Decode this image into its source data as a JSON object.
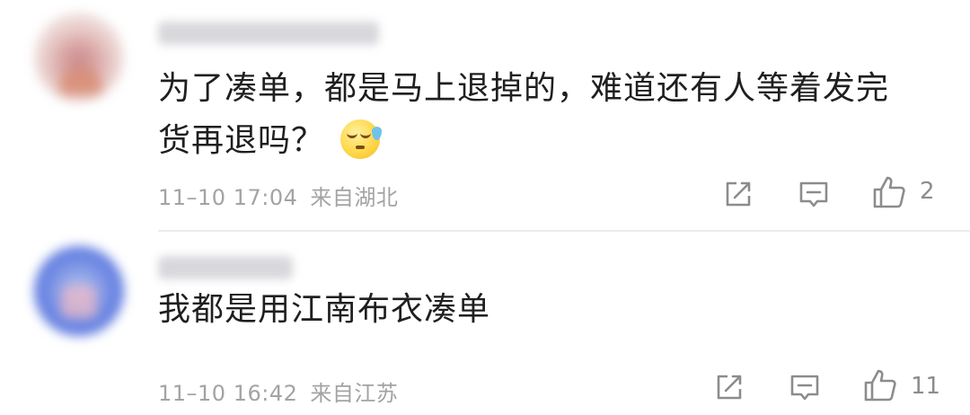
{
  "comments": [
    {
      "text_line1": "为了凑单，都是马上退掉的，难道还有人等着发完",
      "text_line2": "货再退吗？",
      "emoji": "sweat-face-emoji",
      "time": "11–10 17:04",
      "location": "来自湖北",
      "likes": "2"
    },
    {
      "text_line1": "我都是用江南布衣凑单",
      "time": "11–10 16:42",
      "location": "来自江苏",
      "likes": "11"
    }
  ],
  "icons": {
    "share": "share-icon",
    "reply": "comment-icon",
    "like": "thumbs-up-icon"
  },
  "colors": {
    "text": "#1f1f1f",
    "meta": "#a3a3a3",
    "icon": "#8c8c8c",
    "divider": "#ececec"
  }
}
